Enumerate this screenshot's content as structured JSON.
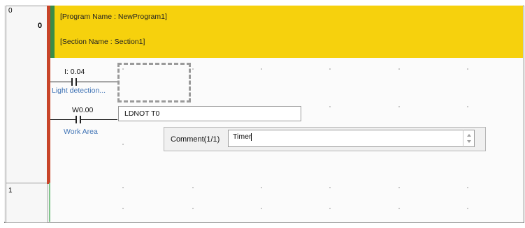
{
  "rungs": [
    {
      "number": "0",
      "step": "0"
    },
    {
      "number": "1"
    }
  ],
  "header": {
    "program_name": "[Program Name : NewProgram1]",
    "section_name": "[Section Name : Section1]"
  },
  "contacts": [
    {
      "address": "I: 0.04",
      "comment": "Light detection..."
    },
    {
      "address": "W0.00",
      "comment": "Work Area"
    }
  ],
  "instruction_input": {
    "value": "LDNOT T0"
  },
  "comment_editor": {
    "label": "Comment(1/1)",
    "value": "Timer"
  },
  "colors": {
    "header_bg": "#f6d10d",
    "rail_red": "#c8452a",
    "rail_green": "#3a8c48",
    "comment_text": "#3f73b5"
  }
}
